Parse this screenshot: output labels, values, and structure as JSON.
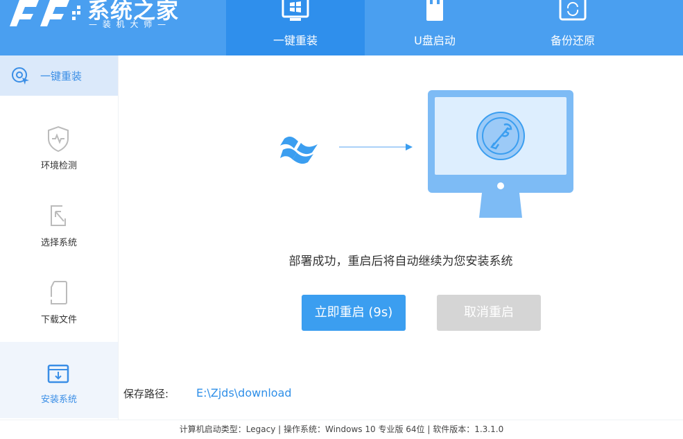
{
  "brand": {
    "title": "系统之家",
    "subtitle": "— 装 机 大 师 —"
  },
  "nav": {
    "tabs": [
      {
        "label": "一键重装",
        "icon": "monitor-windows-icon"
      },
      {
        "label": "U盘启动",
        "icon": "usb-drive-icon"
      },
      {
        "label": "备份还原",
        "icon": "restore-icon"
      }
    ]
  },
  "sidebar": {
    "top": {
      "label": "一键重装",
      "icon": "refresh-cursor-icon"
    },
    "items": [
      {
        "label": "环境检测",
        "icon": "shield-pulse-icon"
      },
      {
        "label": "选择系统",
        "icon": "select-arrow-icon"
      },
      {
        "label": "下载文件",
        "icon": "file-download-icon"
      },
      {
        "label": "安装系统",
        "icon": "install-box-icon"
      }
    ]
  },
  "main": {
    "status": "部署成功，重启后将自动继续为您安装系统",
    "restart_button": "立即重启 (9s)",
    "cancel_button": "取消重启",
    "save_path_label": "保存路径:",
    "save_path_value": "E:\\Zjds\\download"
  },
  "footer": {
    "text": "计算机启动类型：Legacy | 操作系统：Windows 10 专业版 64位 | 软件版本：1.3.1.0"
  },
  "colors": {
    "primary": "#4a9ff0",
    "active_tab": "#2f8fec",
    "button": "#3b9ef0",
    "disabled": "#d5d5d5",
    "accent_text": "#3a8ee6"
  }
}
